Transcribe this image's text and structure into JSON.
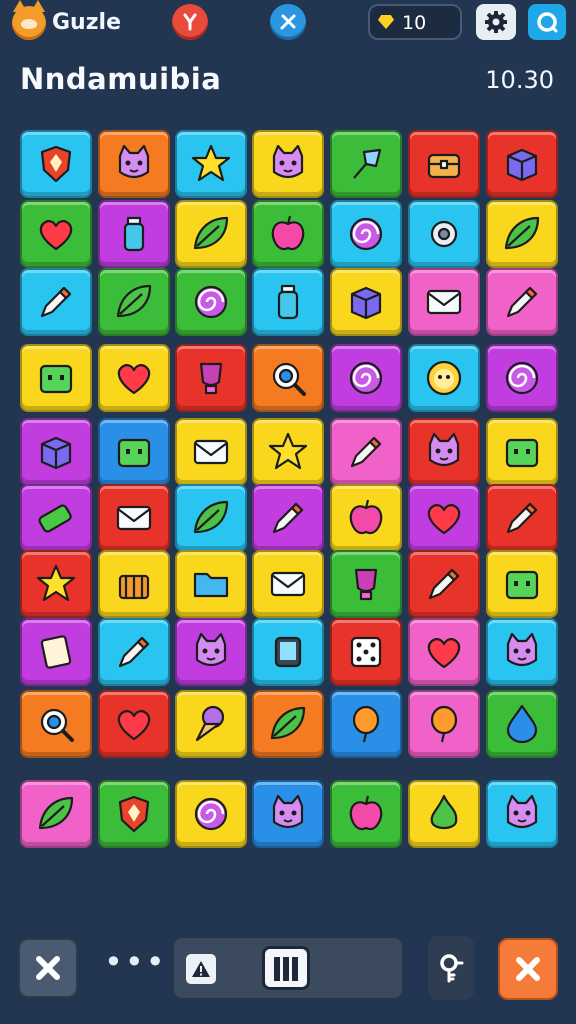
{
  "header": {
    "logo_icon": "fox-face-icon",
    "app_name": "Guzle",
    "red_button_icon": "merge-arrows-icon",
    "blue_button_icon": "tools-icon",
    "gem_icon": "yellow-gem-icon",
    "gem_count": "10",
    "settings_icon": "gear-icon",
    "profile_icon": "profile-ring-icon"
  },
  "level": {
    "title": "Nndamuibia",
    "timer": "10.30"
  },
  "colors": {
    "cyan": "#29c4f0",
    "orange": "#f47b21",
    "yellow": "#f9d71c",
    "green": "#3cbd3a",
    "red": "#e8332a",
    "magenta": "#c13de0",
    "pink": "#f062c8",
    "blue": "#2a8fe6"
  },
  "board": {
    "rows": [
      [
        {
          "color": "cyan",
          "icon": "shield-icon"
        },
        {
          "color": "orange",
          "icon": "cat-face-icon"
        },
        {
          "color": "cyan",
          "icon": "crown-star-icon"
        },
        {
          "color": "yellow",
          "icon": "cat-face-icon"
        },
        {
          "color": "green",
          "icon": "crystal-icon"
        },
        {
          "color": "red",
          "icon": "chest-icon"
        },
        {
          "color": "red",
          "icon": "box-icon"
        }
      ],
      [
        {
          "color": "green",
          "icon": "heart-icon"
        },
        {
          "color": "magenta",
          "icon": "bottle-icon"
        },
        {
          "color": "yellow",
          "icon": "leaf-icon"
        },
        {
          "color": "green",
          "icon": "apple-icon"
        },
        {
          "color": "cyan",
          "icon": "swirl-icon"
        },
        {
          "color": "cyan",
          "icon": "gear-icon"
        },
        {
          "color": "yellow",
          "icon": "leaf-icon"
        }
      ],
      [
        {
          "color": "cyan",
          "icon": "marker-icon"
        },
        {
          "color": "green",
          "icon": "leaf-icon"
        },
        {
          "color": "green",
          "icon": "spiral-candy-icon"
        },
        {
          "color": "cyan",
          "icon": "bottle-icon"
        },
        {
          "color": "yellow",
          "icon": "cube-icon"
        },
        {
          "color": "pink",
          "icon": "envelope-icon"
        },
        {
          "color": "pink",
          "icon": "marker-icon"
        }
      ],
      [
        {
          "color": "yellow",
          "icon": "block-face-icon"
        },
        {
          "color": "yellow",
          "icon": "heart-icon"
        },
        {
          "color": "red",
          "icon": "trophy-icon"
        },
        {
          "color": "orange",
          "icon": "magnifier-icon"
        },
        {
          "color": "magenta",
          "icon": "swirl-icon"
        },
        {
          "color": "cyan",
          "icon": "lion-face-icon"
        },
        {
          "color": "magenta",
          "icon": "spiral-candy-icon"
        }
      ],
      [
        {
          "color": "magenta",
          "icon": "cube-icon"
        },
        {
          "color": "blue",
          "icon": "block-face-icon"
        },
        {
          "color": "yellow",
          "icon": "envelope-icon"
        },
        {
          "color": "yellow",
          "icon": "star-icon"
        },
        {
          "color": "pink",
          "icon": "crayon-icon"
        },
        {
          "color": "red",
          "icon": "cat-face-icon"
        },
        {
          "color": "yellow",
          "icon": "block-face-icon"
        }
      ],
      [
        {
          "color": "magenta",
          "icon": "battery-icon"
        },
        {
          "color": "red",
          "icon": "envelope-icon"
        },
        {
          "color": "cyan",
          "icon": "leaf-icon"
        },
        {
          "color": "magenta",
          "icon": "marker-icon"
        },
        {
          "color": "yellow",
          "icon": "apple-icon"
        },
        {
          "color": "magenta",
          "icon": "heart-icon"
        },
        {
          "color": "red",
          "icon": "marker-icon"
        }
      ],
      [
        {
          "color": "red",
          "icon": "star-icon"
        },
        {
          "color": "yellow",
          "icon": "basket-icon"
        },
        {
          "color": "yellow",
          "icon": "folder-icon"
        },
        {
          "color": "yellow",
          "icon": "envelope-icon"
        },
        {
          "color": "green",
          "icon": "cup-icon"
        },
        {
          "color": "red",
          "icon": "crayon-icon"
        },
        {
          "color": "yellow",
          "icon": "block-face-icon"
        }
      ],
      [
        {
          "color": "magenta",
          "icon": "card-icon"
        },
        {
          "color": "cyan",
          "icon": "marker-icon"
        },
        {
          "color": "magenta",
          "icon": "cat-face-icon"
        },
        {
          "color": "cyan",
          "icon": "tablet-icon"
        },
        {
          "color": "red",
          "icon": "dice-icon"
        },
        {
          "color": "pink",
          "icon": "heart-icon"
        },
        {
          "color": "cyan",
          "icon": "cat-face-icon"
        }
      ],
      [
        {
          "color": "orange",
          "icon": "ring-icon"
        },
        {
          "color": "red",
          "icon": "heart-icon"
        },
        {
          "color": "yellow",
          "icon": "ice-cream-icon"
        },
        {
          "color": "orange",
          "icon": "leaf-icon"
        },
        {
          "color": "blue",
          "icon": "balloon-icon"
        },
        {
          "color": "pink",
          "icon": "balloon-icon"
        },
        {
          "color": "green",
          "icon": "droplet-icon"
        }
      ],
      [
        {
          "color": "pink",
          "icon": "leaf-icon"
        },
        {
          "color": "green",
          "icon": "shield-icon"
        },
        {
          "color": "yellow",
          "icon": "swirl-icon"
        },
        {
          "color": "blue",
          "icon": "cat-face-icon"
        },
        {
          "color": "green",
          "icon": "apple-icon"
        },
        {
          "color": "yellow",
          "icon": "flame-icon"
        },
        {
          "color": "cyan",
          "icon": "cat-face-icon"
        }
      ]
    ]
  },
  "footer": {
    "close_icon": "close-icon",
    "more_label": "•••",
    "warning_icon": "warning-icon",
    "pause_icon": "columns-icon",
    "hint_icon": "key-hint-icon",
    "cancel_icon": "close-icon"
  }
}
